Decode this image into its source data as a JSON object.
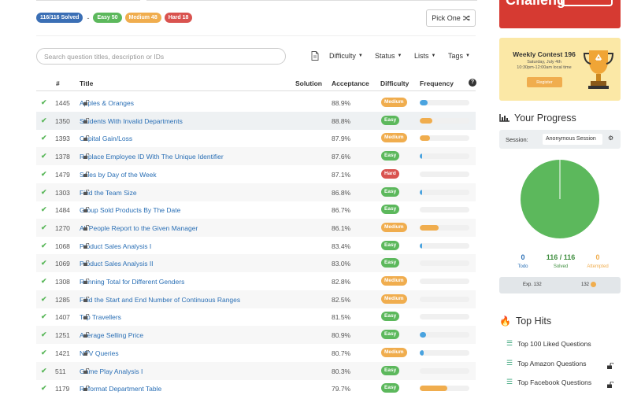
{
  "badges": {
    "solved": "116/116 Solved",
    "separator": "-",
    "easy": "Easy 50",
    "medium": "Medium 48",
    "hard": "Hard 18"
  },
  "pick_one": "Pick One",
  "search": {
    "placeholder": "Search question titles, description or IDs"
  },
  "filters": [
    "Difficulty",
    "Status",
    "Lists",
    "Tags"
  ],
  "columns": {
    "num": "#",
    "title": "Title",
    "solution": "Solution",
    "acceptance": "Acceptance",
    "difficulty": "Difficulty",
    "frequency": "Frequency"
  },
  "colors": {
    "easy": "#5cb85c",
    "medium": "#f0ad4e",
    "hard": "#d9534f",
    "freq_blue": "#4aa3df",
    "freq_orange": "#f0ad4e",
    "link": "#2a6fb5"
  },
  "rows": [
    {
      "id": "1445",
      "title": "Apples & Oranges",
      "acceptance": "88.9%",
      "difficulty": "Medium",
      "frequency": 0.16,
      "freq_color": "blue"
    },
    {
      "id": "1350",
      "title": "Students With Invalid Departments",
      "acceptance": "88.8%",
      "difficulty": "Easy",
      "frequency": 0.25,
      "freq_color": "orange"
    },
    {
      "id": "1393",
      "title": "Capital Gain/Loss",
      "acceptance": "87.9%",
      "difficulty": "Medium",
      "frequency": 0.2,
      "freq_color": "orange"
    },
    {
      "id": "1378",
      "title": "Replace Employee ID With The Unique Identifier",
      "acceptance": "87.6%",
      "difficulty": "Easy",
      "frequency": 0.05,
      "freq_color": "blue"
    },
    {
      "id": "1479",
      "title": "Sales by Day of the Week",
      "acceptance": "87.1%",
      "difficulty": "Hard",
      "frequency": 0,
      "freq_color": "blue"
    },
    {
      "id": "1303",
      "title": "Find the Team Size",
      "acceptance": "86.8%",
      "difficulty": "Easy",
      "frequency": 0.05,
      "freq_color": "blue"
    },
    {
      "id": "1484",
      "title": "Group Sold Products By The Date",
      "acceptance": "86.7%",
      "difficulty": "Easy",
      "frequency": 0,
      "freq_color": "blue"
    },
    {
      "id": "1270",
      "title": "All People Report to the Given Manager",
      "acceptance": "86.1%",
      "difficulty": "Medium",
      "frequency": 0.38,
      "freq_color": "orange"
    },
    {
      "id": "1068",
      "title": "Product Sales Analysis I",
      "acceptance": "83.4%",
      "difficulty": "Easy",
      "frequency": 0.05,
      "freq_color": "blue"
    },
    {
      "id": "1069",
      "title": "Product Sales Analysis II",
      "acceptance": "83.0%",
      "difficulty": "Easy",
      "frequency": 0,
      "freq_color": "blue"
    },
    {
      "id": "1308",
      "title": "Running Total for Different Genders",
      "acceptance": "82.8%",
      "difficulty": "Medium",
      "frequency": 0,
      "freq_color": "blue"
    },
    {
      "id": "1285",
      "title": "Find the Start and End Number of Continuous Ranges",
      "acceptance": "82.5%",
      "difficulty": "Medium",
      "frequency": 0,
      "freq_color": "blue"
    },
    {
      "id": "1407",
      "title": "Top Travellers",
      "acceptance": "81.5%",
      "difficulty": "Easy",
      "frequency": 0,
      "freq_color": "blue"
    },
    {
      "id": "1251",
      "title": "Average Selling Price",
      "acceptance": "80.9%",
      "difficulty": "Easy",
      "frequency": 0.12,
      "freq_color": "blue"
    },
    {
      "id": "1421",
      "title": "NPV Queries",
      "acceptance": "80.7%",
      "difficulty": "Medium",
      "frequency": 0.08,
      "freq_color": "blue"
    },
    {
      "id": "511",
      "title": "Game Play Analysis I",
      "acceptance": "80.3%",
      "difficulty": "Easy",
      "frequency": 0,
      "freq_color": "blue"
    },
    {
      "id": "1179",
      "title": "Reformat Department Table",
      "acceptance": "79.7%",
      "difficulty": "Easy",
      "frequency": 0.55,
      "freq_color": "orange"
    }
  ],
  "contest": {
    "title": "Weekly Contest 196",
    "date": "Saturday, July 4th",
    "time": "10:30pm-12:00am local time",
    "register": "Register"
  },
  "progress": {
    "heading": "Your Progress",
    "session_label": "Session:",
    "session_value": "Anonymous Session",
    "todo_count": "0",
    "todo_label": "Todo",
    "solved_count": "116 / 116",
    "solved_label": "Solved",
    "attempted_count": "0",
    "attempted_label": "Attempted",
    "exp_label": "Exp. 132",
    "coins": "132",
    "pie_solved_fraction": 1.0
  },
  "top_hits": {
    "heading": "Top Hits",
    "items": [
      "Top 100 Liked Questions",
      "Top Amazon Questions",
      "Top Facebook Questions"
    ]
  }
}
